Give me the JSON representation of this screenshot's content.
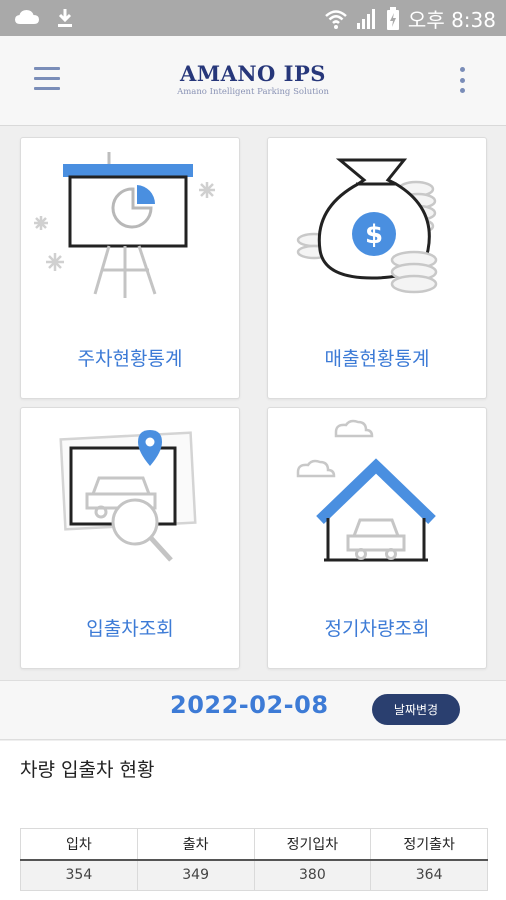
{
  "status_bar": {
    "time": "오후 8:38",
    "icons": [
      "cloud-icon",
      "download-icon",
      "wifi-icon",
      "signal-icon",
      "battery-icon"
    ]
  },
  "app_bar": {
    "brand": "AMANO IPS",
    "tagline": "Amano Intelligent Parking Solution",
    "menu_icon": "hamburger-icon",
    "more_icon": "more-vert-icon"
  },
  "tiles": [
    {
      "label": "주차현황통계",
      "icon": "presentation-chart-icon"
    },
    {
      "label": "매출현황통계",
      "icon": "money-bag-icon"
    },
    {
      "label": "입출차조회",
      "icon": "car-search-icon"
    },
    {
      "label": "정기차량조회",
      "icon": "garage-icon"
    }
  ],
  "date_bar": {
    "date": "2022-02-08",
    "change_label": "날짜변경"
  },
  "section": {
    "title": "차량 입출차 현황"
  },
  "stats_table": {
    "headers": [
      "입차",
      "출차",
      "정기입차",
      "정기출차"
    ],
    "values": [
      "354",
      "349",
      "380",
      "364"
    ]
  },
  "colors": {
    "accent_blue": "#3d7bd6",
    "brand_navy": "#27377a",
    "button_navy": "#2a3f6f",
    "status_bar": "#a9a9a9"
  }
}
